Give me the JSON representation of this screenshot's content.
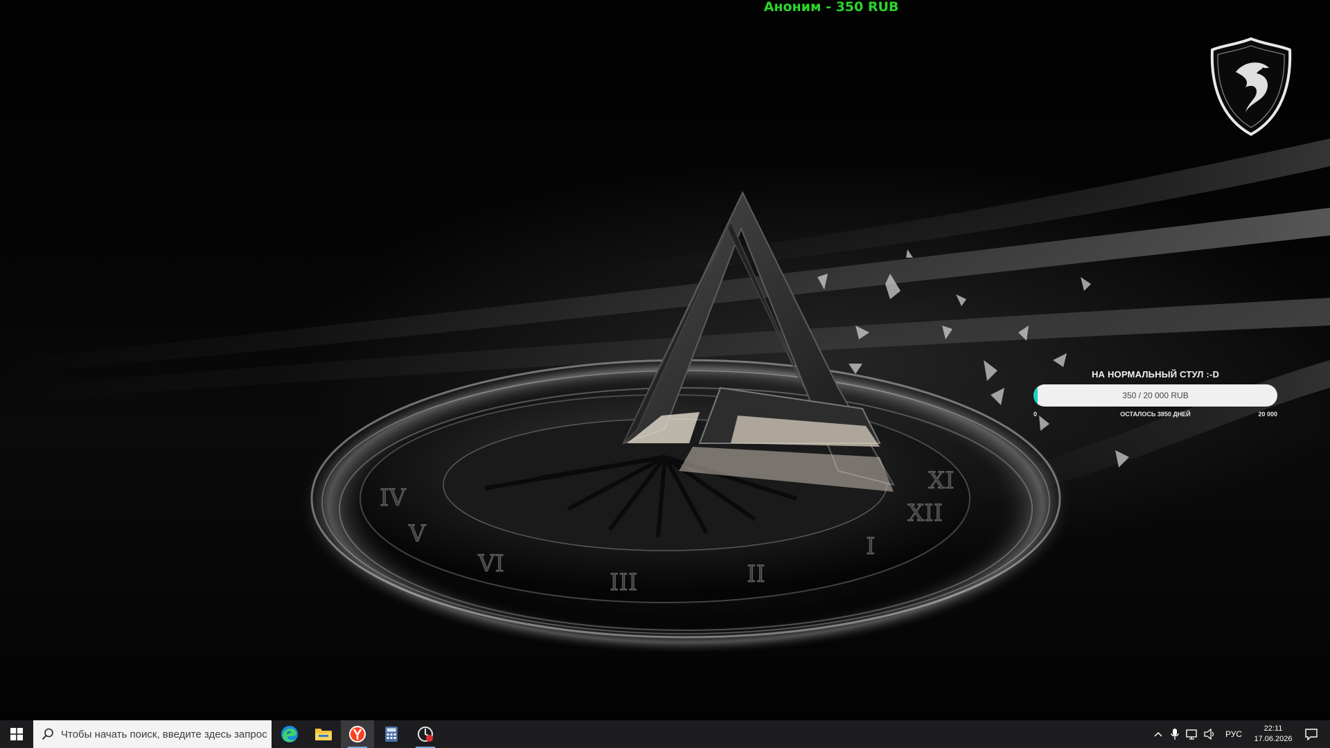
{
  "alert": {
    "donation_text": "Аноним - 350 RUB",
    "color": "#2bd62b"
  },
  "goal": {
    "title": "НА НОРМАЛЬНЫЙ СТУЛ :-D",
    "progress_text": "350 / 20 000 RUB",
    "current": 350,
    "target": 20000,
    "min_label": "0",
    "max_label": "20 000",
    "remaining_label": "ОСТАЛОСЬ 3850 ДНЕЙ",
    "fill_color": "#18d3c0"
  },
  "wallpaper": {
    "numerals": [
      "III",
      "II",
      "I",
      "XII",
      "XI",
      "VI",
      "V",
      "IV"
    ]
  },
  "taskbar": {
    "start_icon": "windows-logo-icon",
    "search_placeholder": "Чтобы начать поиск, введите здесь запрос",
    "apps": [
      {
        "name": "Microsoft Edge",
        "icon": "edge-icon"
      },
      {
        "name": "File Explorer",
        "icon": "folder-icon"
      },
      {
        "name": "Yandex Browser",
        "icon": "yandex-icon"
      },
      {
        "name": "Calculator",
        "icon": "calculator-icon"
      },
      {
        "name": "Screen recorder",
        "icon": "recorder-icon"
      }
    ],
    "tray": {
      "language": "РУС",
      "time": "22:11",
      "date": "17.06.2026"
    }
  }
}
